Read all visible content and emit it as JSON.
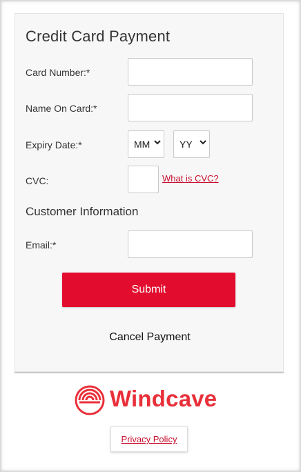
{
  "form": {
    "title": "Credit Card Payment",
    "card_number": {
      "label": "Card Number:*",
      "value": ""
    },
    "name_on_card": {
      "label": "Name On Card:*",
      "value": ""
    },
    "expiry": {
      "label": "Expiry Date:*",
      "month_selected": "MM",
      "year_selected": "YY"
    },
    "cvc": {
      "label": "CVC:",
      "value": "",
      "help_link": "What is CVC?"
    },
    "customer_section": "Customer Information",
    "email": {
      "label": "Email:*",
      "value": ""
    },
    "submit_label": "Submit",
    "cancel_label": "Cancel Payment"
  },
  "footer": {
    "brand": "Windcave",
    "privacy_label": "Privacy Policy"
  },
  "colors": {
    "accent": "#e20d2e",
    "brand": "#e8303a",
    "link": "#c8102e",
    "panel_bg": "#f7f7f7"
  },
  "icons": [
    "chevron-down-icon",
    "windcave-logo-icon"
  ]
}
